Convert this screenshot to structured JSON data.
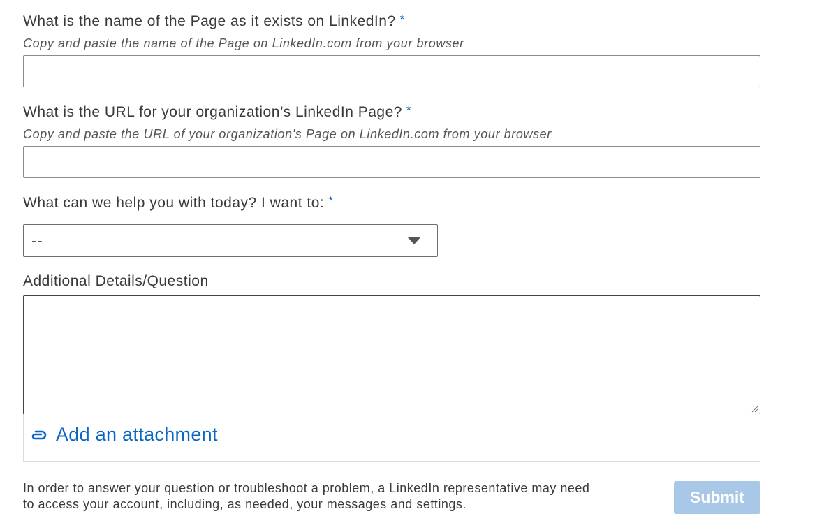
{
  "form": {
    "fields": {
      "page_name": {
        "label": "What is the name of the Page as it exists on LinkedIn?",
        "required_marker": "*",
        "hint": "Copy and paste the name of the Page on LinkedIn.com from your browser",
        "value": ""
      },
      "page_url": {
        "label": "What is the URL for your organization’s LinkedIn Page?",
        "required_marker": "*",
        "hint": "Copy and paste the URL of your organization's Page on LinkedIn.com from your browser",
        "value": ""
      },
      "help_topic": {
        "label": "What can we help you with today? I want to:",
        "required_marker": "*",
        "selected": "--"
      },
      "details": {
        "label": "Additional Details/Question",
        "value": ""
      }
    },
    "attachment": {
      "label": "Add an attachment",
      "icon": "paperclip-icon"
    },
    "disclaimer": "In order to answer your question or troubleshoot a problem, a LinkedIn representative may need to access your account, including, as needed, your messages and settings.",
    "submit_label": "Submit"
  },
  "colors": {
    "accent": "#0a66c2",
    "submit_disabled_bg": "#a9c7e6"
  }
}
